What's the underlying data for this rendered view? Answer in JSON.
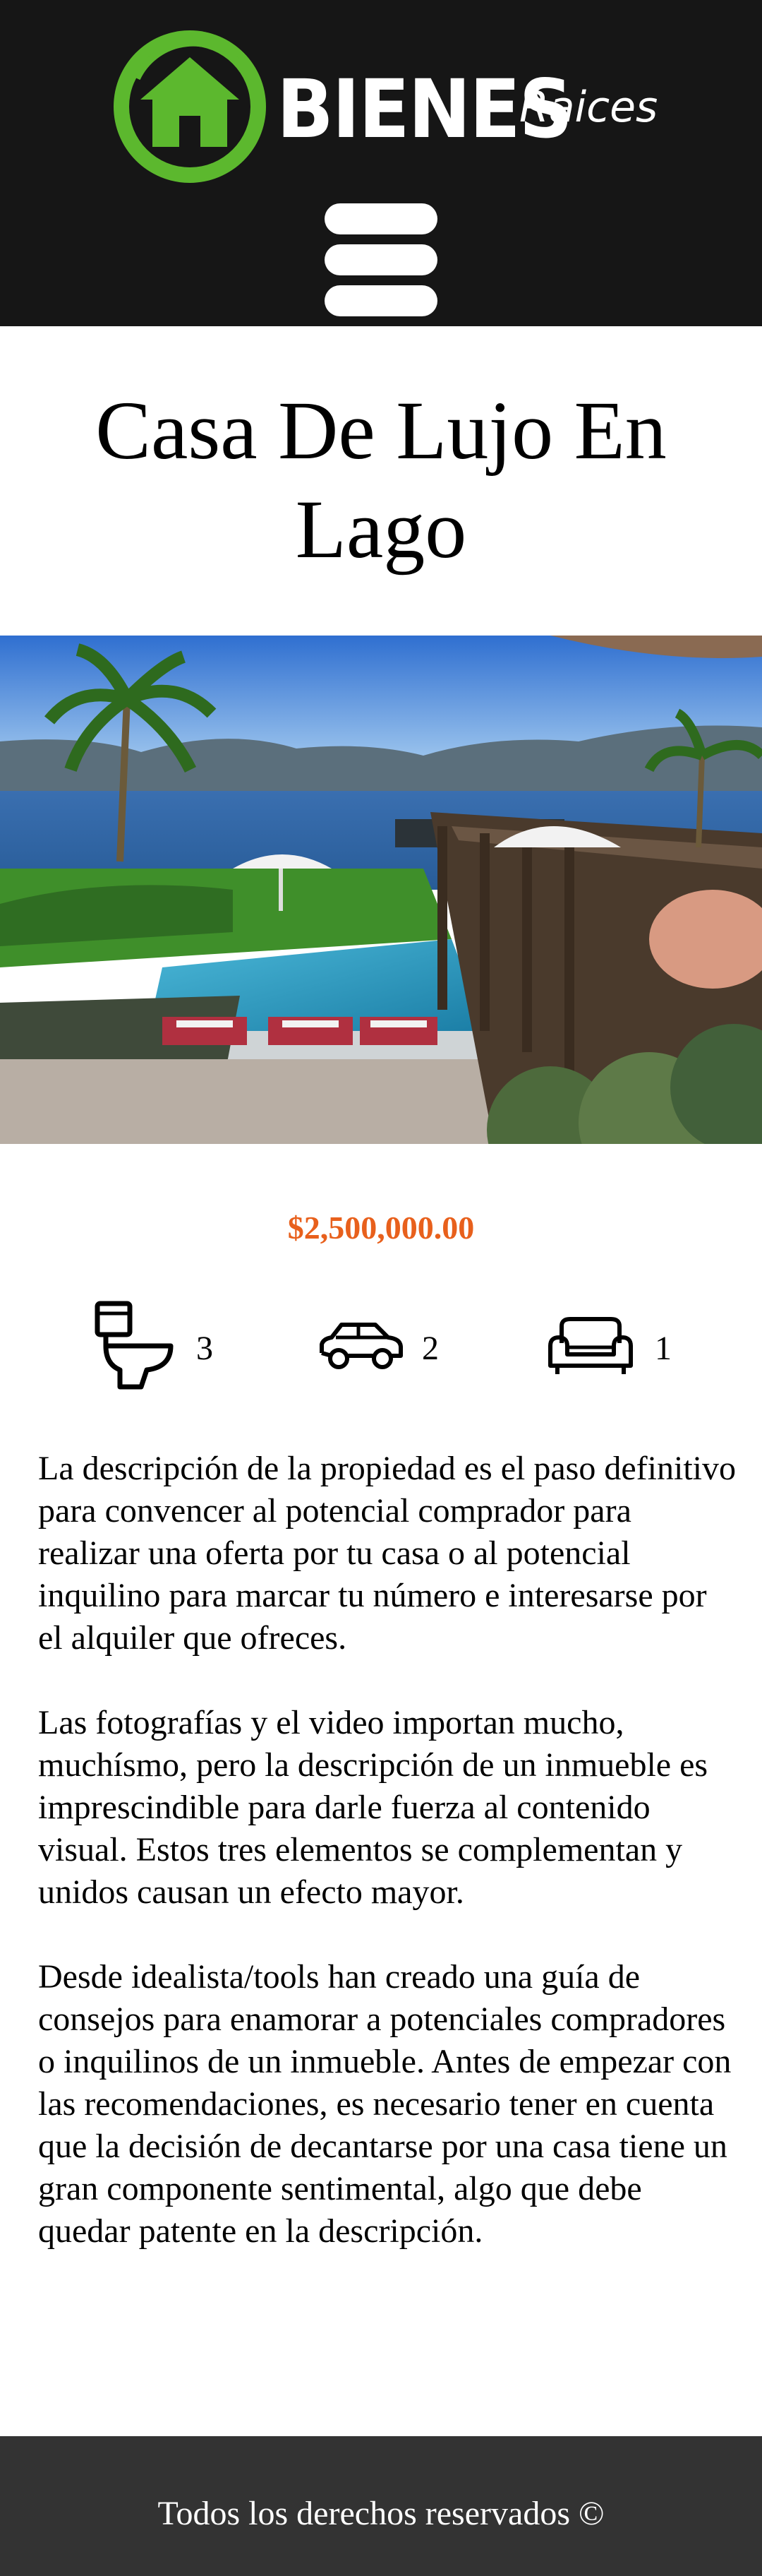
{
  "header": {
    "logo_main": "BIENES",
    "logo_sub": "Raices",
    "menu_icon": "hamburger-menu-icon",
    "logo_icon": "house-logo-icon"
  },
  "property": {
    "title": "Casa De Lujo En Lago",
    "image_alt": "lake-house-pool-photo",
    "price": "$2,500,000.00",
    "features": [
      {
        "icon": "toilet-icon",
        "label": "baños",
        "value": "3"
      },
      {
        "icon": "car-icon",
        "label": "estacionamiento",
        "value": "2"
      },
      {
        "icon": "sofa-icon",
        "label": "habitaciones",
        "value": "1"
      }
    ],
    "description": [
      "La descripción de la propiedad es el paso definitivo para convencer al potencial comprador para realizar una oferta por tu casa o al potencial inquilino para marcar tu número e interesarse por el alquiler que ofreces.",
      "Las fotografías y el video importan mucho, muchísmo, pero la descripción de un inmueble es imprescindible para darle fuerza al contenido visual. Estos tres elementos se complementan y unidos causan un efecto mayor.",
      "Desde idealista/tools han creado una guía de consejos para enamorar a potenciales compradores o inquilinos de un inmueble. Antes de empezar con las recomendaciones, es necesario tener en cuenta que la decisión de decantarse por una casa tiene un gran componente sentimental, algo que debe quedar patente en la descripción."
    ]
  },
  "footer": {
    "copyright": "Todos los derechos reservados ©"
  },
  "colors": {
    "header_bg": "#161616",
    "logo_green": "#5cb82e",
    "price": "#e8601c",
    "footer_bg": "#333333"
  }
}
